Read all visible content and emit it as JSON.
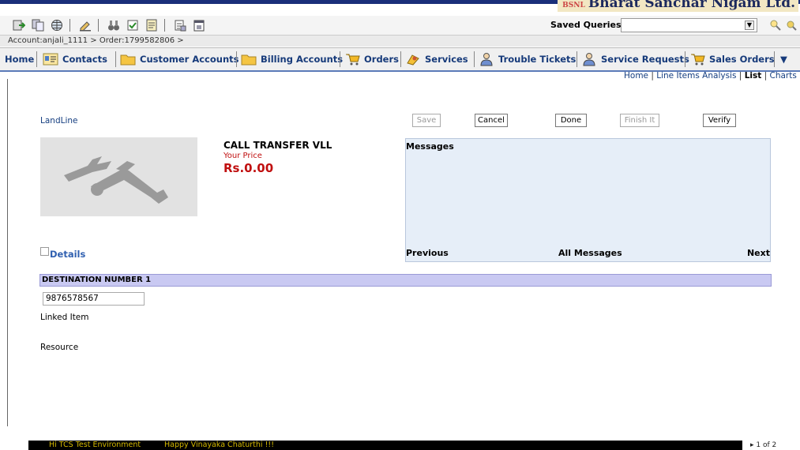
{
  "brand": {
    "prefix": "BSNL",
    "name": "Bharat Sanchar Nigam Ltd."
  },
  "toolbar": {
    "saved_queries_label": "Saved Queries:",
    "saved_queries_value": ""
  },
  "breadcrumb": "Account:anjali_1111  > Order:1799582806  >",
  "tabs": [
    {
      "label": "Home",
      "icon": ""
    },
    {
      "label": "Contacts",
      "icon": "contacts-icon"
    },
    {
      "label": "Customer Accounts",
      "icon": "folder-icon"
    },
    {
      "label": "Billing Accounts",
      "icon": "folder-icon"
    },
    {
      "label": "Orders",
      "icon": "cart-icon"
    },
    {
      "label": "Services",
      "icon": "services-icon"
    },
    {
      "label": "Trouble Tickets",
      "icon": "person-icon"
    },
    {
      "label": "Service Requests",
      "icon": "person-icon"
    },
    {
      "label": "Sales Orders",
      "icon": "cart-icon"
    }
  ],
  "subnav": {
    "home": "Home",
    "line_items": "Line Items Analysis",
    "list": "List",
    "charts": "Charts",
    "sep": "|"
  },
  "product": {
    "category": "LandLine",
    "name": "CALL TRANSFER VLL",
    "price_label": "Your Price",
    "price": "Rs.0.00",
    "details_label": "Details"
  },
  "buttons": {
    "save": "Save",
    "cancel": "Cancel",
    "done": "Done",
    "finish": "Finish It",
    "verify": "Verify"
  },
  "messages": {
    "title": "Messages",
    "previous": "Previous",
    "all": "All Messages",
    "next": "Next"
  },
  "destination": {
    "header": "DESTINATION NUMBER 1",
    "value": "9876578567"
  },
  "labels": {
    "linked_item": "Linked Item",
    "resource": "Resource"
  },
  "ticker": {
    "text1": "Hi TCS Test Environment",
    "text2": "Happy Vinayaka Chaturthi !!!",
    "page": "1 of 2"
  }
}
